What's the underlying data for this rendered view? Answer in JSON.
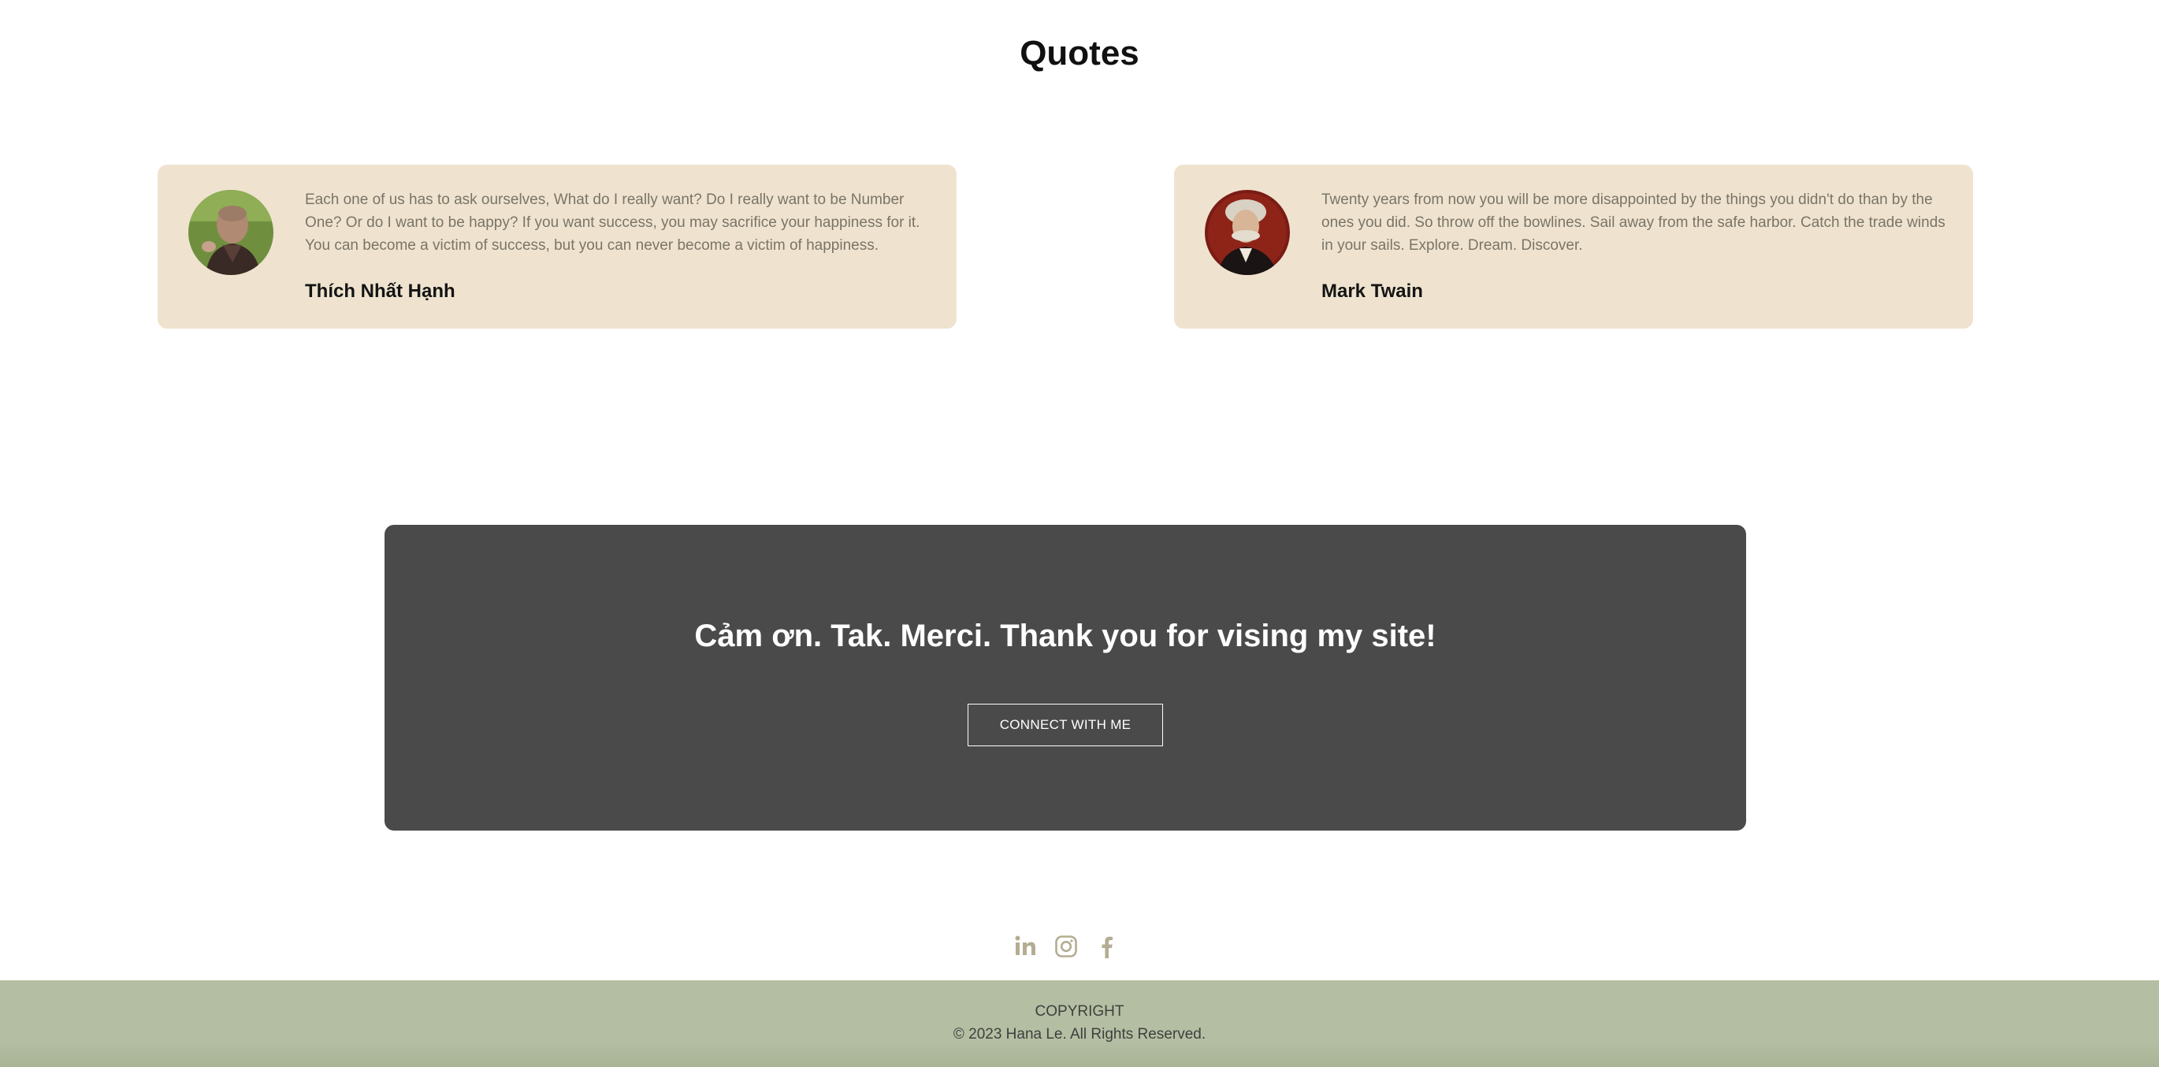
{
  "quotes_section": {
    "title": "Quotes",
    "items": [
      {
        "text": "Each one of us has to ask ourselves, What do I really want? Do I really want to be Number One? Or do I want to be happy? If you want success, you may sacrifice your happiness for it. You can become a victim of success, but you can never become a victim of happiness.",
        "author": "Thích Nhất Hạnh",
        "avatar_icon": "portrait-photo"
      },
      {
        "text": "Twenty years from now you will be more disappointed by the things you didn't do than by the ones you did. So throw off the bowlines. Sail away from the safe harbor. Catch the trade winds in your sails. Explore. Dream. Discover.",
        "author": "Mark Twain",
        "avatar_icon": "portrait-painting"
      }
    ]
  },
  "cta": {
    "heading": "Cảm ơn. Tak. Merci. Thank you for vising my site!",
    "button_label": "CONNECT WITH ME"
  },
  "social": {
    "icons": [
      "linkedin-icon",
      "instagram-icon",
      "facebook-icon"
    ],
    "icon_color": "#b4ad93"
  },
  "footer": {
    "copyright_label": "COPYRIGHT",
    "rights_text": "© 2023 Hana Le. All Rights Reserved."
  },
  "colors": {
    "card_background": "#efe3cf",
    "cta_background": "#4a4a4a",
    "footer_background": "#b4bea2"
  }
}
